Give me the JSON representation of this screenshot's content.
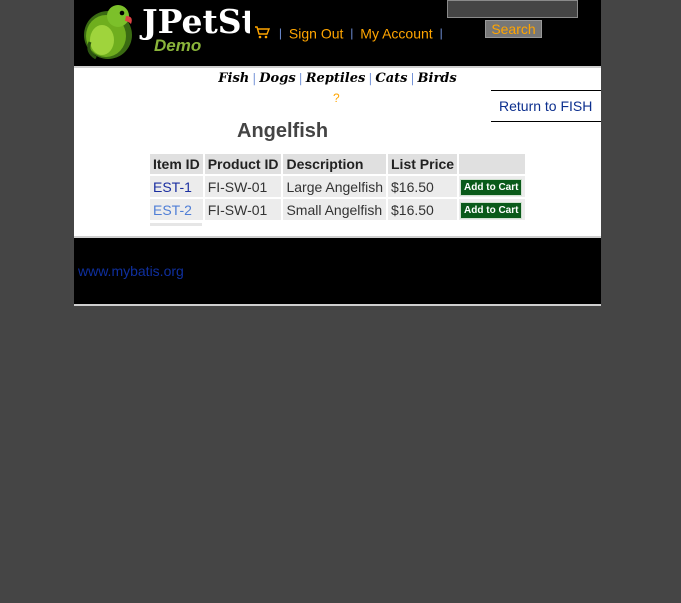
{
  "header": {
    "logo_text": "JPetSto",
    "logo_subtitle": "Demo",
    "menu": {
      "sign_out": "Sign Out",
      "my_account": "My Account",
      "separator": "|"
    },
    "search": {
      "value": "",
      "button_label": "Search"
    }
  },
  "quicklinks": [
    "Fish",
    "Dogs",
    "Reptiles",
    "Cats",
    "Birds"
  ],
  "help_label": "?",
  "return_link": "Return to FISH",
  "product": {
    "title": "Angelfish"
  },
  "items_table": {
    "headers": [
      "Item ID",
      "Product ID",
      "Description",
      "List Price",
      ""
    ],
    "rows": [
      {
        "item_id": "EST-1",
        "product_id": "FI-SW-01",
        "description": "Large Angelfish",
        "price": "$16.50",
        "action": "Add to Cart"
      },
      {
        "item_id": "EST-2",
        "product_id": "FI-SW-01",
        "description": "Small Angelfish",
        "price": "$16.50",
        "action": "Add to Cart"
      }
    ]
  },
  "footer": {
    "link": "www.mybatis.org"
  },
  "colors": {
    "page_bg": "#454545",
    "header_bg": "#000000",
    "menu_text": "#ffa500",
    "add_button": "#0a5a1a",
    "link_blue": "#0c2f8e"
  },
  "icons": [
    "parrot-logo-icon",
    "cart-icon"
  ]
}
